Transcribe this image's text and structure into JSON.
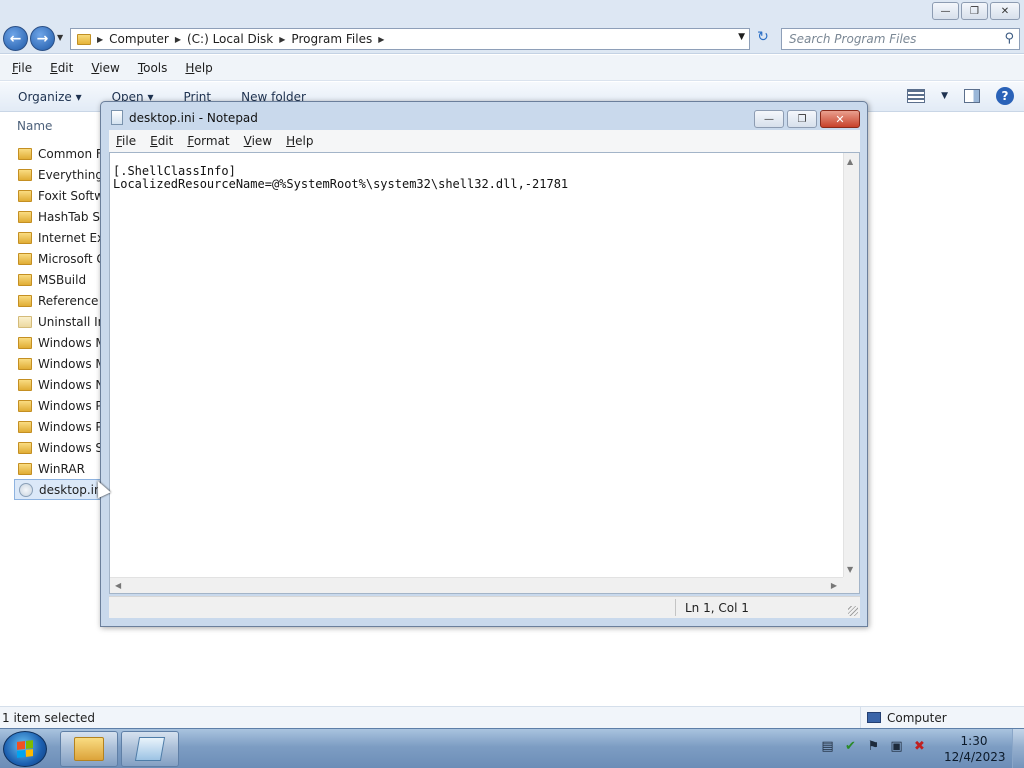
{
  "explorer": {
    "breadcrumb": [
      "Computer",
      "(C:) Local Disk",
      "Program Files"
    ],
    "search_placeholder": "Search Program Files",
    "menu": [
      "File",
      "Edit",
      "View",
      "Tools",
      "Help"
    ],
    "commands": [
      "Organize",
      "Open",
      "Print",
      "New folder"
    ],
    "column_header": "Name",
    "files": [
      {
        "name": "Common Fi",
        "type": "folder"
      },
      {
        "name": "Everything",
        "type": "folder"
      },
      {
        "name": "Foxit Softwa",
        "type": "folder"
      },
      {
        "name": "HashTab Sh",
        "type": "folder"
      },
      {
        "name": "Internet Exp",
        "type": "folder"
      },
      {
        "name": "Microsoft G",
        "type": "folder"
      },
      {
        "name": "MSBuild",
        "type": "folder"
      },
      {
        "name": "Reference A",
        "type": "folder"
      },
      {
        "name": "Uninstall Inf",
        "type": "folder-pale"
      },
      {
        "name": "Windows M",
        "type": "folder"
      },
      {
        "name": "Windows M",
        "type": "folder"
      },
      {
        "name": "Windows N",
        "type": "folder"
      },
      {
        "name": "Windows Pl",
        "type": "folder"
      },
      {
        "name": "Windows Po",
        "type": "folder"
      },
      {
        "name": "Windows Si",
        "type": "folder"
      },
      {
        "name": "WinRAR",
        "type": "folder"
      },
      {
        "name": "desktop.ini",
        "type": "ini",
        "selected": true
      }
    ],
    "status_left": "1 item selected",
    "status_right": "Computer"
  },
  "notepad": {
    "title": "desktop.ini - Notepad",
    "menu": [
      "File",
      "Edit",
      "Format",
      "View",
      "Help"
    ],
    "content": "[.ShellClassInfo]\nLocalizedResourceName=@%SystemRoot%\\system32\\shell32.dll,-21781",
    "status_position": "Ln 1, Col 1"
  },
  "taskbar": {
    "clock_time": "1:30",
    "clock_date": "12/4/2023",
    "tray_icons": [
      "action-center-icon",
      "security-icon",
      "flag-icon",
      "network-icon",
      "volume-muted-icon"
    ],
    "start_flag_colors": [
      "#f25022",
      "#7fba00",
      "#00a4ef",
      "#ffb900"
    ]
  }
}
